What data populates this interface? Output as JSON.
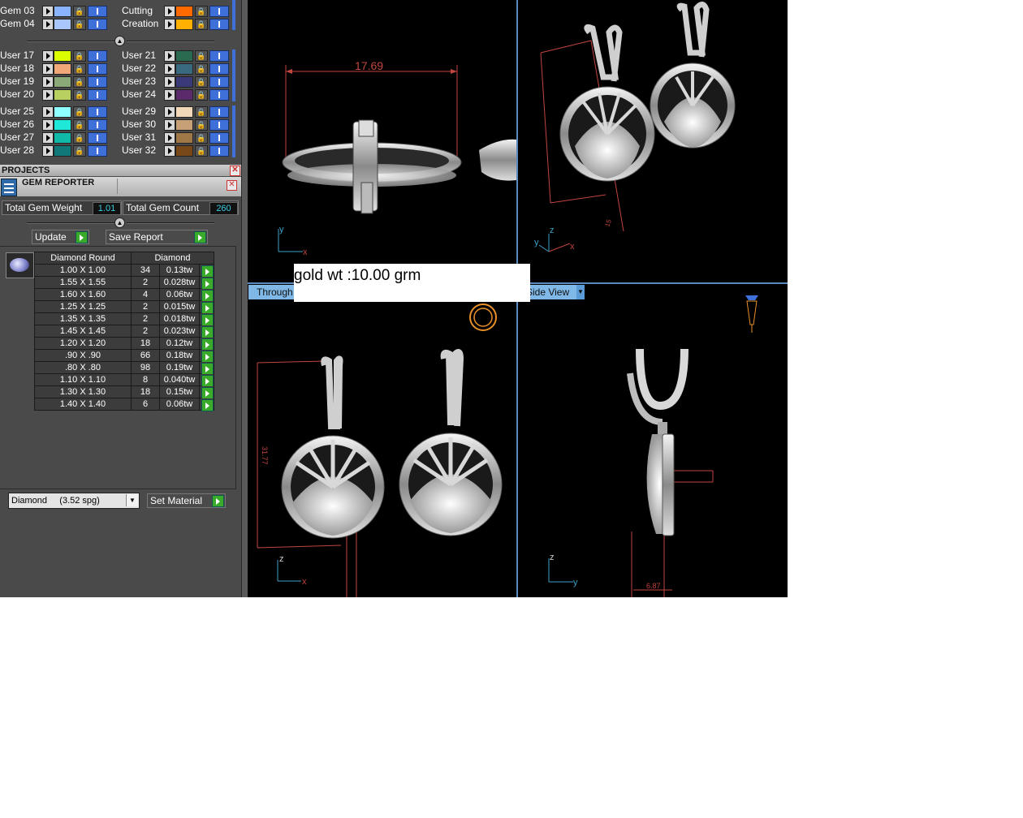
{
  "layers": {
    "gem_rows_left": [
      {
        "label": "Gem 03",
        "color": "#8ab4ff"
      },
      {
        "label": "Gem 04",
        "color": "#a9c6ff"
      }
    ],
    "gem_rows_right": [
      {
        "label": "Cutting",
        "color": "#ff6a00"
      },
      {
        "label": "Creation",
        "color": "#ffb000"
      }
    ],
    "user_group_1_left": [
      {
        "label": "User 17",
        "color": "#dcff00"
      },
      {
        "label": "User 18",
        "color": "#f0a878"
      },
      {
        "label": "User 19",
        "color": "#8aa878"
      },
      {
        "label": "User 20",
        "color": "#b8d060"
      }
    ],
    "user_group_1_right": [
      {
        "label": "User 21",
        "color": "#2a6a50"
      },
      {
        "label": "User 22",
        "color": "#3a6a80"
      },
      {
        "label": "User 23",
        "color": "#3a3a78"
      },
      {
        "label": "User 24",
        "color": "#5a2a6a"
      }
    ],
    "user_group_2_left": [
      {
        "label": "User 25",
        "color": "#90ffff"
      },
      {
        "label": "User 26",
        "color": "#20e8d8"
      },
      {
        "label": "User 27",
        "color": "#10b8a8"
      },
      {
        "label": "User 28",
        "color": "#107878"
      }
    ],
    "user_group_2_right": [
      {
        "label": "User 29",
        "color": "#f0d8b8"
      },
      {
        "label": "User 30",
        "color": "#c8a078"
      },
      {
        "label": "User 31",
        "color": "#a07848"
      },
      {
        "label": "User 32",
        "color": "#784818"
      }
    ]
  },
  "projects": {
    "title": "PROJECTS"
  },
  "gem_reporter": {
    "title": "GEM REPORTER",
    "total_weight_label": "Total Gem Weight",
    "total_weight_value": "1.01",
    "total_count_label": "Total Gem Count",
    "total_count_value": "260",
    "update_label": "Update",
    "save_report_label": "Save Report",
    "col_shape": "Diamond Round",
    "col_material": "Diamond",
    "rows": [
      {
        "size": "1.00 X 1.00",
        "count": "34",
        "weight": "0.13tw"
      },
      {
        "size": "1.55 X 1.55",
        "count": "2",
        "weight": "0.028tw"
      },
      {
        "size": "1.60 X 1.60",
        "count": "4",
        "weight": "0.06tw"
      },
      {
        "size": "1.25 X 1.25",
        "count": "2",
        "weight": "0.015tw"
      },
      {
        "size": "1.35 X 1.35",
        "count": "2",
        "weight": "0.018tw"
      },
      {
        "size": "1.45 X 1.45",
        "count": "2",
        "weight": "0.023tw"
      },
      {
        "size": "1.20 X 1.20",
        "count": "18",
        "weight": "0.12tw"
      },
      {
        "size": ".90 X .90",
        "count": "66",
        "weight": "0.18tw"
      },
      {
        "size": ".80 X .80",
        "count": "98",
        "weight": "0.19tw"
      },
      {
        "size": "1.10 X 1.10",
        "count": "8",
        "weight": "0.040tw"
      },
      {
        "size": "1.30 X 1.30",
        "count": "18",
        "weight": "0.15tw"
      },
      {
        "size": "1.40 X 1.40",
        "count": "6",
        "weight": "0.06tw"
      }
    ],
    "material_select": "Diamond     (3.52 spg)",
    "set_material_label": "Set Material"
  },
  "viewports": {
    "top_left": {
      "dimension": "17.69",
      "axis_a": "y",
      "axis_b": "x"
    },
    "top_right": {
      "axis_a": "z",
      "axis_b": "x",
      "axis_c": "y"
    },
    "bottom_left": {
      "tab": "Through",
      "dimension": "31.77",
      "axis_a": "z",
      "axis_b": "x"
    },
    "bottom_right": {
      "tab": "Side View",
      "dimension": "6.87",
      "axis_a": "z",
      "axis_b": "y"
    }
  },
  "overlay_note": "gold wt :10.00 grm"
}
